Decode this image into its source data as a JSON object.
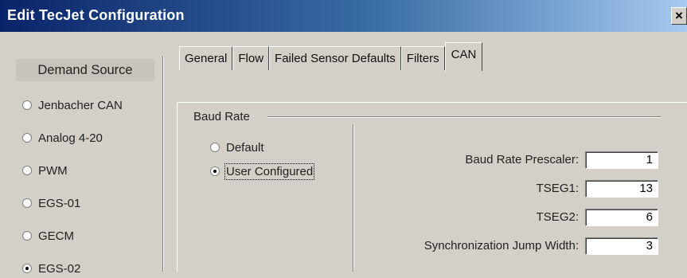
{
  "window": {
    "title": "Edit TecJet Configuration",
    "close_glyph": "×"
  },
  "demand_source": {
    "label": "Demand Source",
    "options": [
      {
        "label": "Jenbacher CAN",
        "checked": false
      },
      {
        "label": "Analog 4-20",
        "checked": false
      },
      {
        "label": "PWM",
        "checked": false
      },
      {
        "label": "EGS-01",
        "checked": false
      },
      {
        "label": "GECM",
        "checked": false
      },
      {
        "label": "EGS-02",
        "checked": true
      }
    ]
  },
  "tabs": [
    {
      "label": "General",
      "active": false
    },
    {
      "label": "Flow",
      "active": false
    },
    {
      "label": "Failed Sensor Defaults",
      "active": false
    },
    {
      "label": "Filters",
      "active": false
    },
    {
      "label": "CAN",
      "active": true
    }
  ],
  "baud_rate": {
    "title": "Baud Rate",
    "options": [
      {
        "label": "Default",
        "checked": false
      },
      {
        "label": "User Configured",
        "checked": true
      }
    ],
    "fields": [
      {
        "label": "Baud Rate Prescaler:",
        "value": "1"
      },
      {
        "label": "TSEG1:",
        "value": "13"
      },
      {
        "label": "TSEG2:",
        "value": "6"
      },
      {
        "label": "Synchronization Jump Width:",
        "value": "3"
      }
    ]
  }
}
